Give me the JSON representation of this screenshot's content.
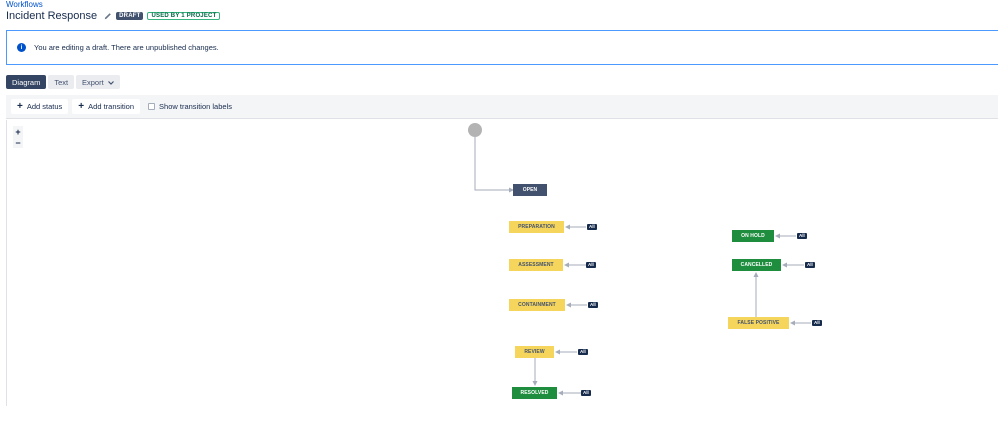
{
  "breadcrumb": "Workflows",
  "title": "Incident Response",
  "badges": {
    "draft": "DRAFT",
    "used": "USED BY 1 PROJECT"
  },
  "banner": {
    "icon": "info-icon",
    "text": "You are editing a draft. There are unpublished changes."
  },
  "view_tabs": {
    "diagram": "Diagram",
    "text": "Text"
  },
  "export_label": "Export",
  "toolbar": {
    "add_status": "Add status",
    "add_transition": "Add transition",
    "show_labels": "Show transition labels",
    "show_labels_checked": false
  },
  "zoom": {
    "in": "+",
    "out": "−"
  },
  "statuses": {
    "open": "OPEN",
    "preparation": "PREPARATION",
    "assessment": "ASSESSMENT",
    "containment": "CONTAINMENT",
    "review": "REVIEW",
    "resolved": "RESOLVED",
    "on_hold": "ON HOLD",
    "cancelled": "CANCELLED",
    "false_positive": "FALSE POSITIVE"
  },
  "global_transition_label": "All",
  "colors": {
    "todo": "#42526e",
    "in_progress": "#f6d55c",
    "done": "#1e8e3e",
    "link": "#0052cc"
  }
}
